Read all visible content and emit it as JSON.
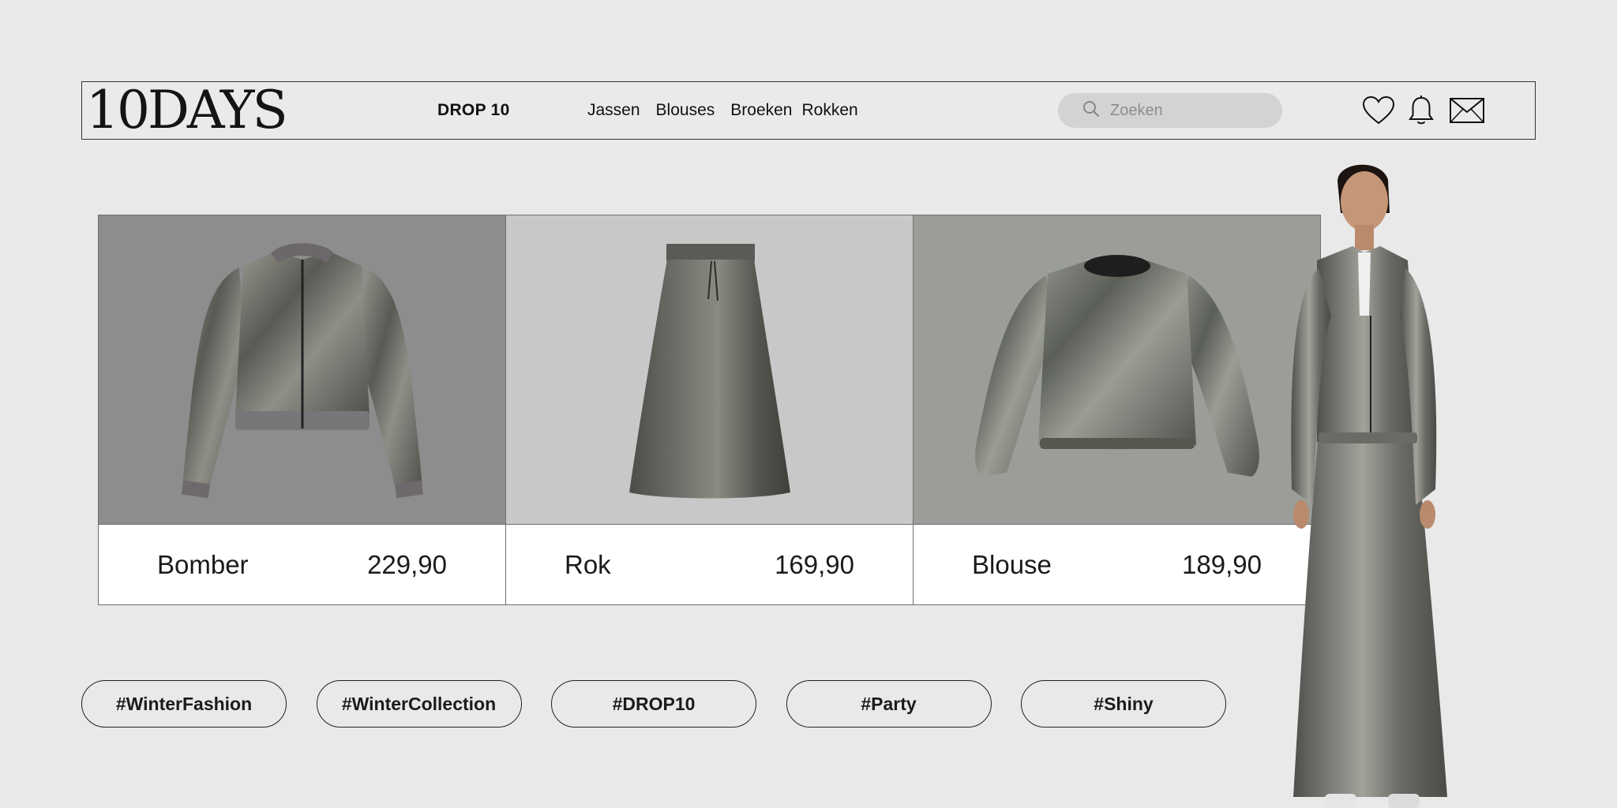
{
  "header": {
    "logo": "10DAYS",
    "drop_label": "DROP 10",
    "nav": [
      "Jassen",
      "Blouses",
      "Broeken",
      "Rokken"
    ],
    "search_placeholder": "Zoeken",
    "icons": [
      "heart-icon",
      "bell-icon",
      "mail-icon"
    ]
  },
  "products": [
    {
      "name": "Bomber",
      "price": "229,90",
      "bg": "#8d8d8d"
    },
    {
      "name": "Rok",
      "price": "169,90",
      "bg": "#c8c8c8"
    },
    {
      "name": "Blouse",
      "price": "189,90",
      "bg": "#9b9e98"
    }
  ],
  "tags": [
    "#WinterFashion",
    "#WinterCollection",
    "#DROP10",
    "#Party",
    "#Shiny"
  ],
  "colors": {
    "page_bg": "#e9e9e9",
    "search_bg": "#d3d3d3",
    "metallic": "#6e6e6e"
  }
}
